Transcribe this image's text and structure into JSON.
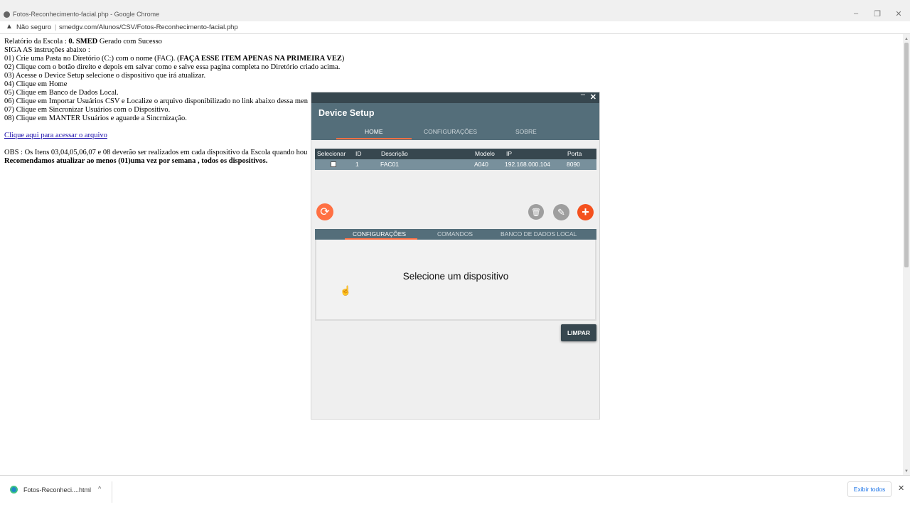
{
  "browser": {
    "title": "Fotos-Reconhecimento-facial.php - Google Chrome",
    "not_secure": "Não seguro",
    "url": "smedgv.com/Alunos/CSV/Fotos-Reconhecimento-facial.php",
    "minimize": "–",
    "restore": "❐",
    "close": "✕"
  },
  "report": {
    "line1_prefix": "Relatório da Escola : ",
    "school": "0. SMED",
    "line1_suffix": " Gerado com Sucesso",
    "line2": "SIGA AS instruções abaixo :",
    "step01_prefix": "01) Crie uma Pasta no Diretório (C:) com o nome (FAC). (",
    "step01_bold": "FAÇA ESSE ITEM APENAS NA PRIMEIRA VEZ",
    "step01_suffix": ")",
    "step02": "02) Clique com o botão direito e depois em salvar como e salve essa pagina completa no Diretório criado acima.",
    "step03": "03) Acesse o Device Setup selecione o dispositivo que irá atualizar.",
    "step04": "04) Clique em Home",
    "step05": "05) Clique em Banco de Dados Local.",
    "step06": "06) Clique em Importar Usuários CSV e Localize o arquivo disponibilizado no link abaixo dessa men",
    "step07": "07) Clique em Sincronizar Usuários com o Dispositivo.",
    "step08": "08) Clique em MANTER Usuários e aguarde a Sincrnização.",
    "link": "Clique aqui para acessar o arquivo",
    "obs": "OBS : Os Itens 03,04,05,06,07 e 08 deverão ser realizados em cada dispositivo da Escola quando hou",
    "recommendation": "Recomendamos atualizar ao menos (01)uma vez por semana , todos os dispositivos."
  },
  "device_setup": {
    "title": "Device Setup",
    "minimize": "–",
    "close": "✕",
    "tabs": [
      "HOME",
      "CONFIGURAÇÕES",
      "SOBRE"
    ],
    "table": {
      "headers": [
        "Selecionar",
        "ID",
        "Descrição",
        "Modelo",
        "IP",
        "Porta"
      ],
      "rows": [
        {
          "id": "1",
          "descricao": "FAC01",
          "modelo": "A040",
          "ip": "192.168.000.104",
          "porta": "8090"
        }
      ]
    },
    "subtabs": [
      "CONFIGURAÇÕES",
      "COMANDOS",
      "BANCO DE DADOS LOCAL"
    ],
    "panel_message": "Selecione um dispositivo",
    "clear_button": "LIMPAR",
    "icons": {
      "refresh": "⟳",
      "delete": "🗑",
      "edit": "✎",
      "add": "+"
    },
    "colors": {
      "dark": "#37474f",
      "header": "#546e7a",
      "row": "#78909c",
      "accent": "#ff7043"
    }
  },
  "downloads": {
    "file": "Fotos-Reconheci....html",
    "chevron": "^",
    "show_all": "Exibir todos",
    "close": "✕"
  }
}
